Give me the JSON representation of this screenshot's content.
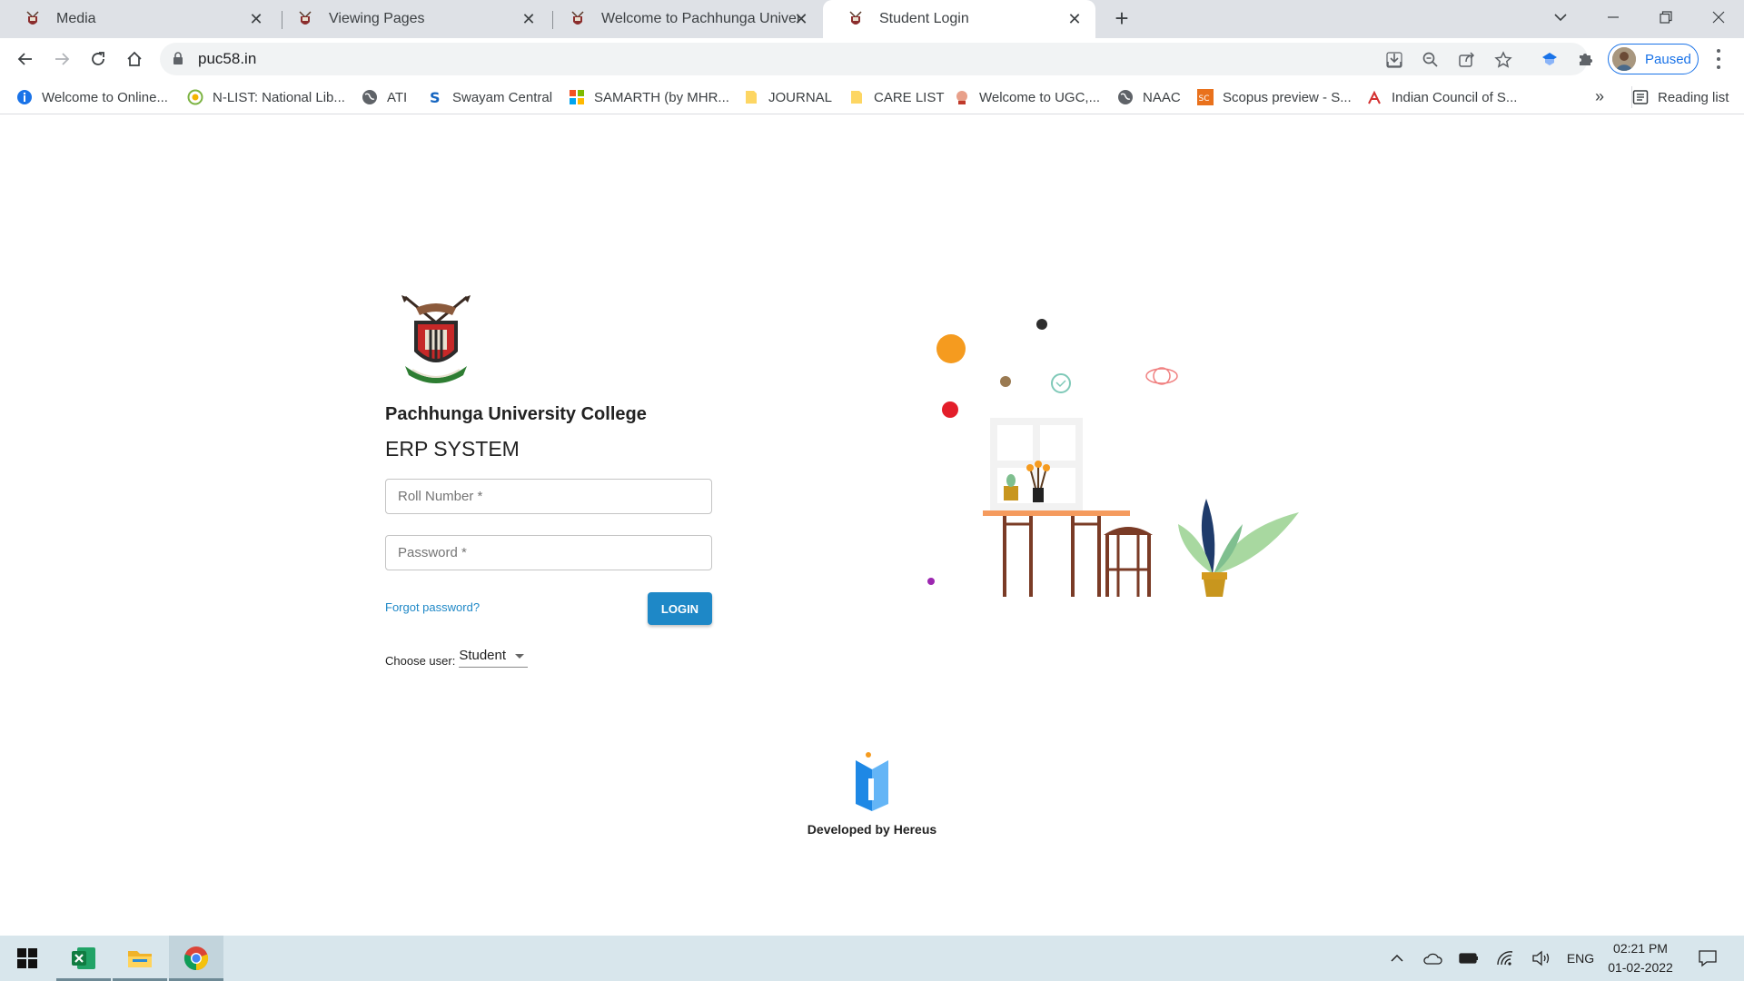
{
  "browser": {
    "tabs": [
      {
        "title": "Media",
        "active": false
      },
      {
        "title": "Viewing Pages",
        "active": false
      },
      {
        "title": "Welcome to Pachhunga Universit",
        "active": false
      },
      {
        "title": "Student Login",
        "active": true
      }
    ],
    "new_tab_label": "+",
    "url": "puc58.in",
    "profile_status": "Paused",
    "bookmarks": [
      {
        "label": "Welcome to Online...",
        "icon": "info-circle-icon"
      },
      {
        "label": "N-LIST: National Lib...",
        "icon": "nlist-icon"
      },
      {
        "label": "ATI",
        "icon": "globe-icon"
      },
      {
        "label": "Swayam Central",
        "icon": "swayam-icon"
      },
      {
        "label": "SAMARTH (by MHR...",
        "icon": "windows-grid-icon"
      },
      {
        "label": "JOURNAL",
        "icon": "folder-icon"
      },
      {
        "label": "CARE LIST",
        "icon": "folder-icon"
      },
      {
        "label": "Welcome to UGC,...",
        "icon": "ugc-icon"
      },
      {
        "label": "NAAC",
        "icon": "globe-icon"
      },
      {
        "label": "Scopus preview - S...",
        "icon": "scopus-icon"
      },
      {
        "label": "Indian Council of S...",
        "icon": "icssr-icon"
      }
    ],
    "bookmarks_overflow": "»",
    "reading_list": "Reading list"
  },
  "page": {
    "college_name": "Pachhunga University College",
    "system_name": "ERP SYSTEM",
    "roll_placeholder": "Roll Number *",
    "password_placeholder": "Password *",
    "forgot_password": "Forgot password?",
    "login_button": "LOGIN",
    "choose_user_label": "Choose user:",
    "choose_user_value": "Student",
    "developer_credit": "Developed by Hereus"
  },
  "taskbar": {
    "apps": [
      "windows-start-icon",
      "excel-icon",
      "file-explorer-icon",
      "chrome-icon"
    ],
    "language": "ENG",
    "time": "02:21 PM",
    "date": "01-02-2022"
  },
  "colors": {
    "accent": "#1e88c7",
    "chrome_blue": "#1a73e8",
    "tabstrip": "#dee1e6",
    "taskbar": "#d8e6ec"
  }
}
